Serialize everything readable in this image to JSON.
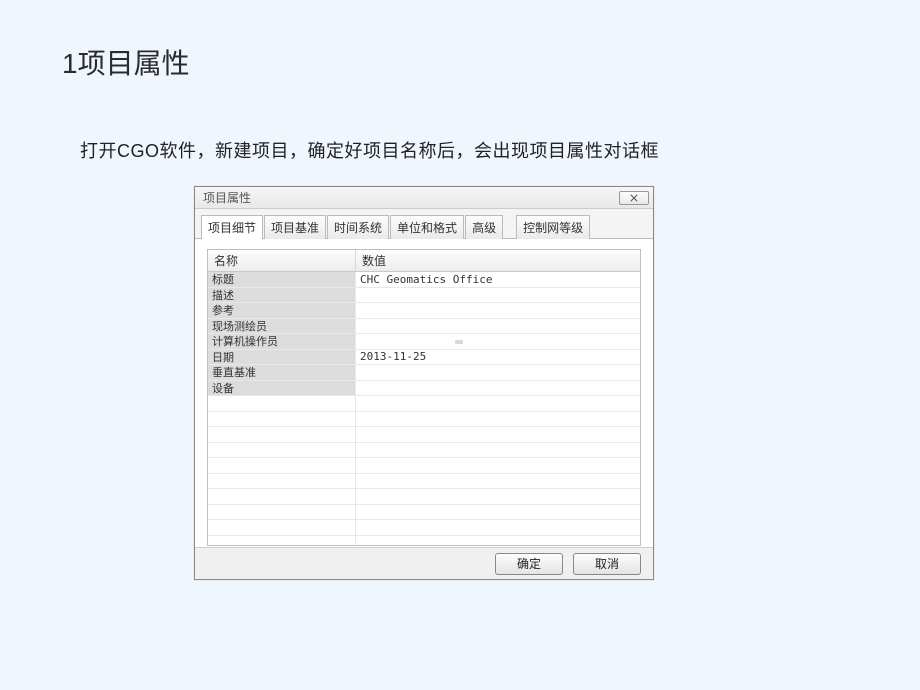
{
  "page": {
    "title": "1项目属性",
    "description": "打开CGO软件，新建项目，确定好项目名称后，会出现项目属性对话框"
  },
  "dialog": {
    "title": "项目属性",
    "tabs": [
      {
        "label": "项目细节",
        "active": true
      },
      {
        "label": "项目基准",
        "active": false
      },
      {
        "label": "时间系统",
        "active": false
      },
      {
        "label": "单位和格式",
        "active": false
      },
      {
        "label": "高级",
        "active": false
      },
      {
        "label": "控制网等级",
        "active": false
      }
    ],
    "grid": {
      "headers": {
        "name": "名称",
        "value": "数值"
      },
      "rows": [
        {
          "name": "标题",
          "value": "CHC Geomatics Office"
        },
        {
          "name": "描述",
          "value": ""
        },
        {
          "name": "参考",
          "value": ""
        },
        {
          "name": "现场测绘员",
          "value": ""
        },
        {
          "name": "计算机操作员",
          "value": ""
        },
        {
          "name": "日期",
          "value": "2013-11-25"
        },
        {
          "name": "垂直基准",
          "value": ""
        },
        {
          "name": "设备",
          "value": ""
        }
      ]
    },
    "buttons": {
      "ok": "确定",
      "cancel": "取消"
    }
  }
}
